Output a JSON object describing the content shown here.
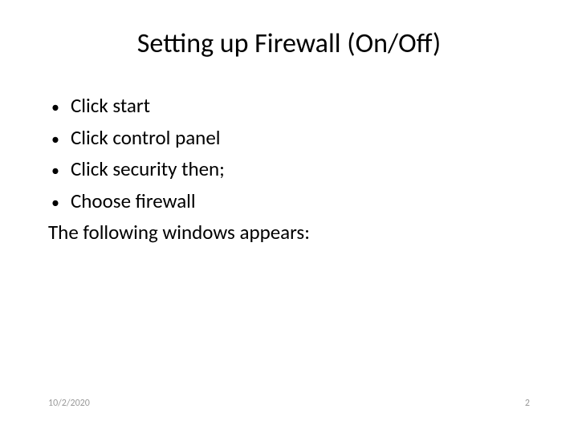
{
  "title": "Setting up Firewall (On/Off)",
  "bullets": [
    "Click start",
    "Click control panel",
    "Click security then;",
    "Choose firewall"
  ],
  "body_text": "The following windows appears:",
  "footer": {
    "date": "10/2/2020",
    "page_number": "2"
  }
}
